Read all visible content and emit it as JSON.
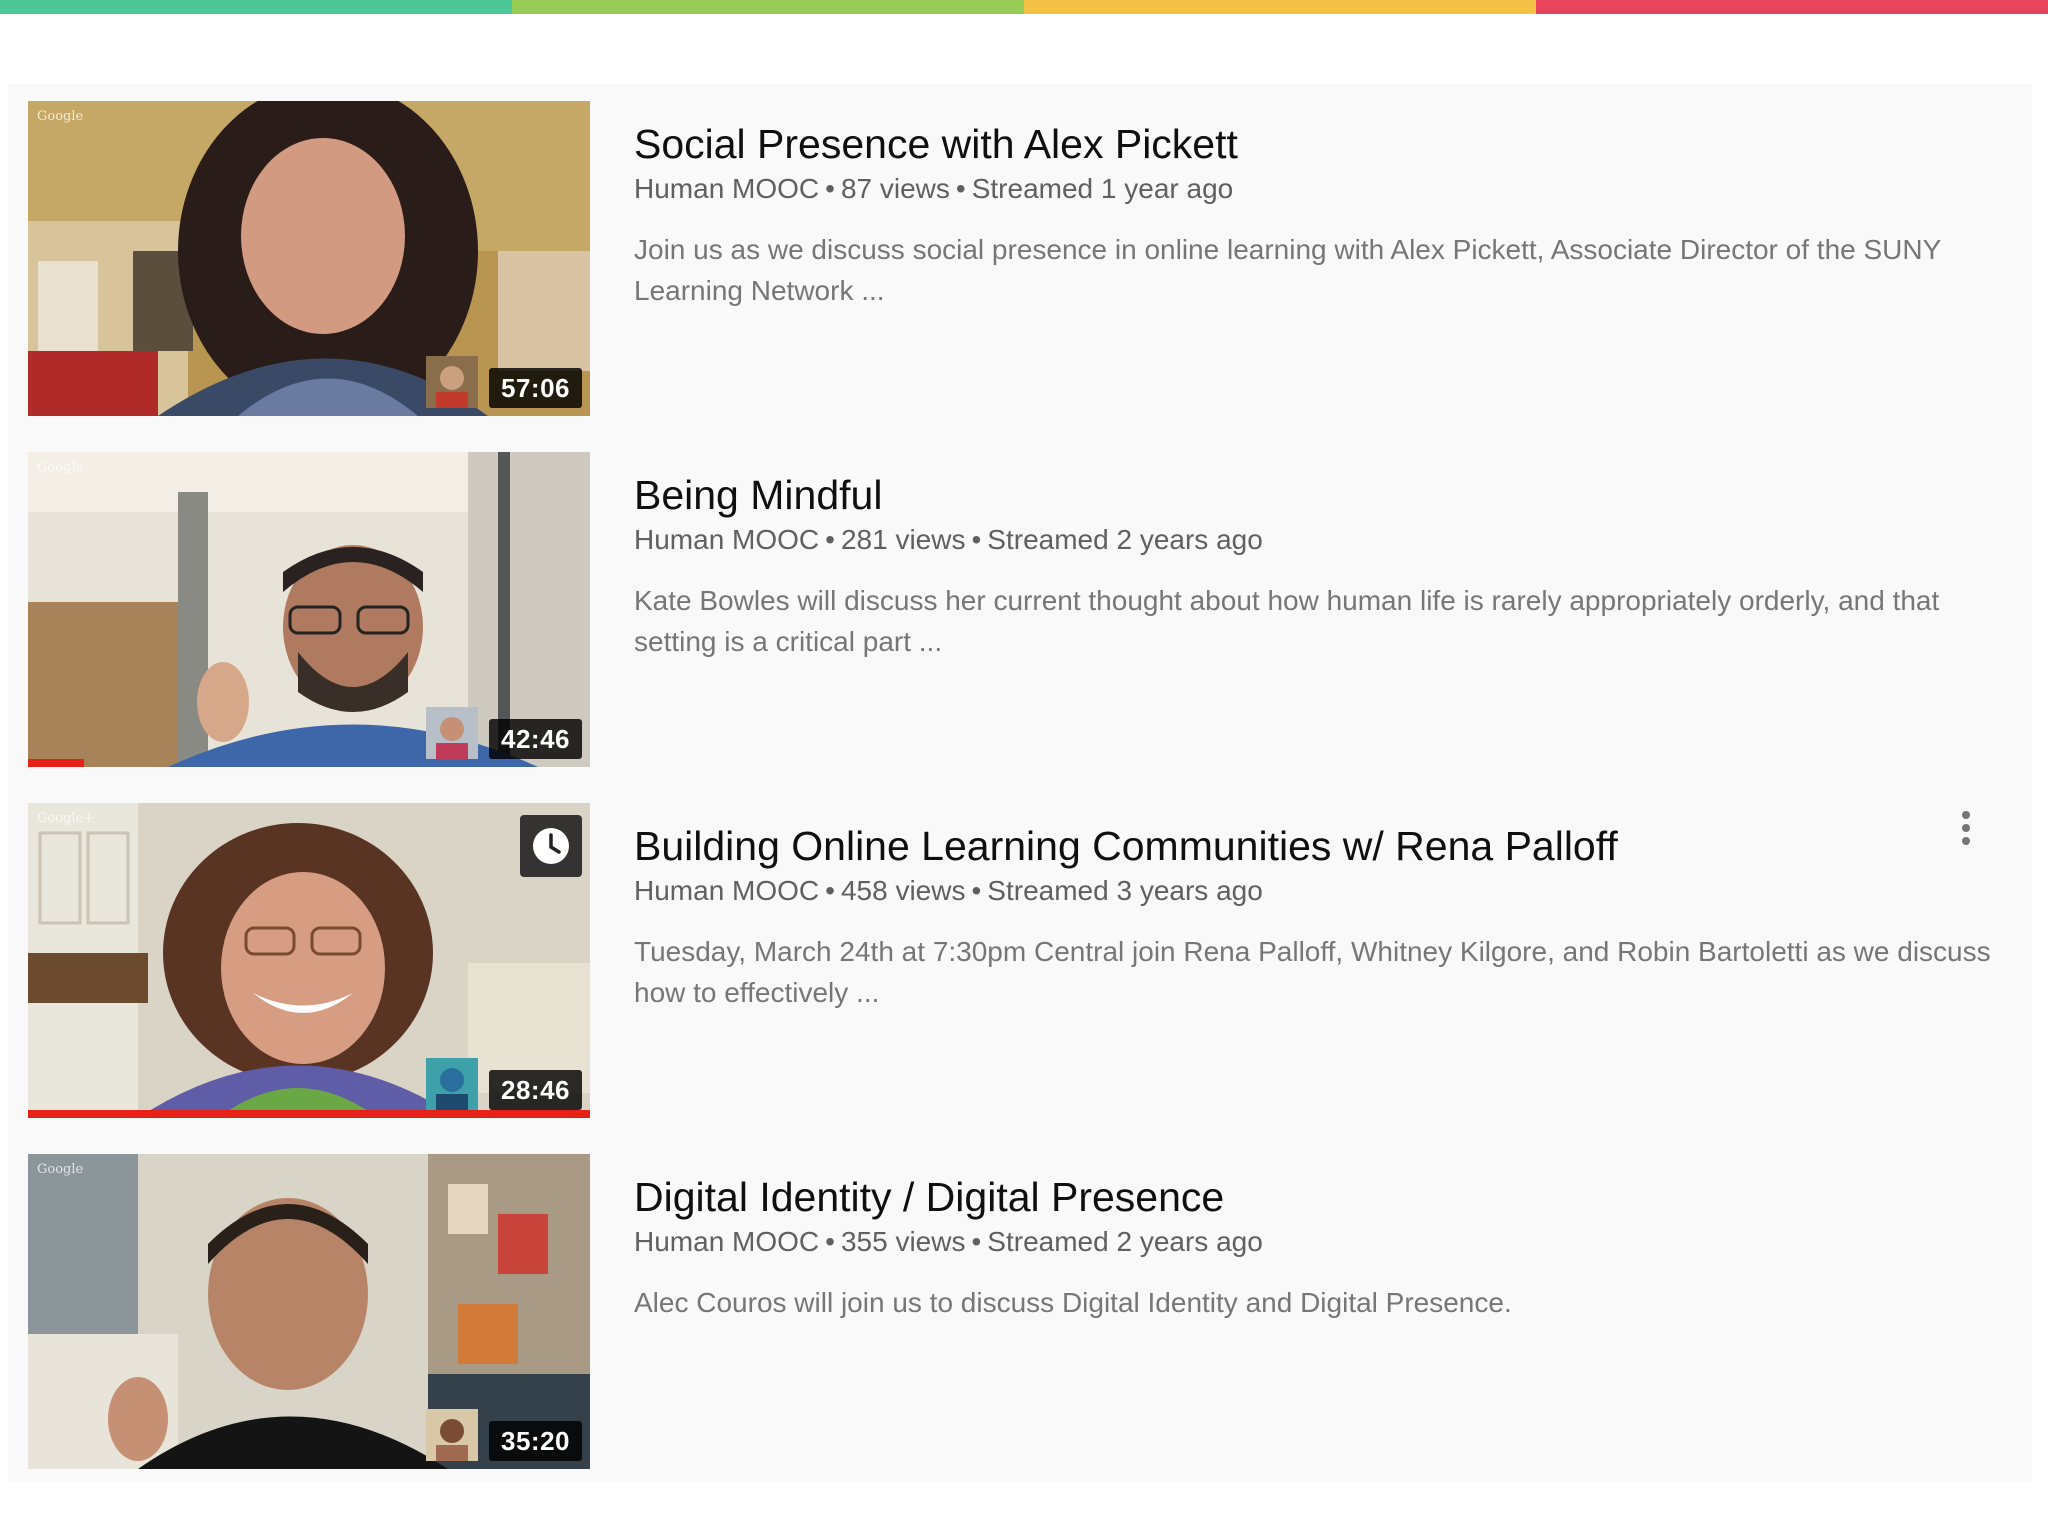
{
  "colors": {
    "stripe": [
      "#4cc898",
      "#97cc57",
      "#f2c144",
      "#e8455d"
    ],
    "progress": "#e62117"
  },
  "videos": [
    {
      "title": "Social Presence with Alex Pickett",
      "channel": "Human MOOC",
      "views": "87 views",
      "age": "Streamed 1 year ago",
      "description": "Join us as we discuss social presence in online learning with Alex Pickett, Associate Director of the SUNY Learning Network ...",
      "duration": "57:06",
      "watermark": "Google",
      "watch_progress": 0
    },
    {
      "title": "Being Mindful",
      "channel": "Human MOOC",
      "views": "281 views",
      "age": "Streamed 2 years ago",
      "description": "Kate Bowles will discuss her current thought about how human life is rarely appropriately orderly, and that setting is a critical part ...",
      "duration": "42:46",
      "watermark": "Google",
      "watch_progress": 0.1
    },
    {
      "title": "Building Online Learning Communities w/ Rena Palloff",
      "channel": "Human MOOC",
      "views": "458 views",
      "age": "Streamed 3 years ago",
      "description": "Tuesday, March 24th at 7:30pm Central join Rena Palloff, Whitney Kilgore, and Robin Bartoletti as we discuss how to effectively ...",
      "duration": "28:46",
      "watermark": "Google+",
      "watch_progress": 1.0
    },
    {
      "title": "Digital Identity / Digital Presence",
      "channel": "Human MOOC",
      "views": "355 views",
      "age": "Streamed 2 years ago",
      "description": "Alec Couros will join us to discuss Digital Identity and Digital Presence.",
      "duration": "35:20",
      "watermark": "Google",
      "watch_progress": 0
    }
  ]
}
